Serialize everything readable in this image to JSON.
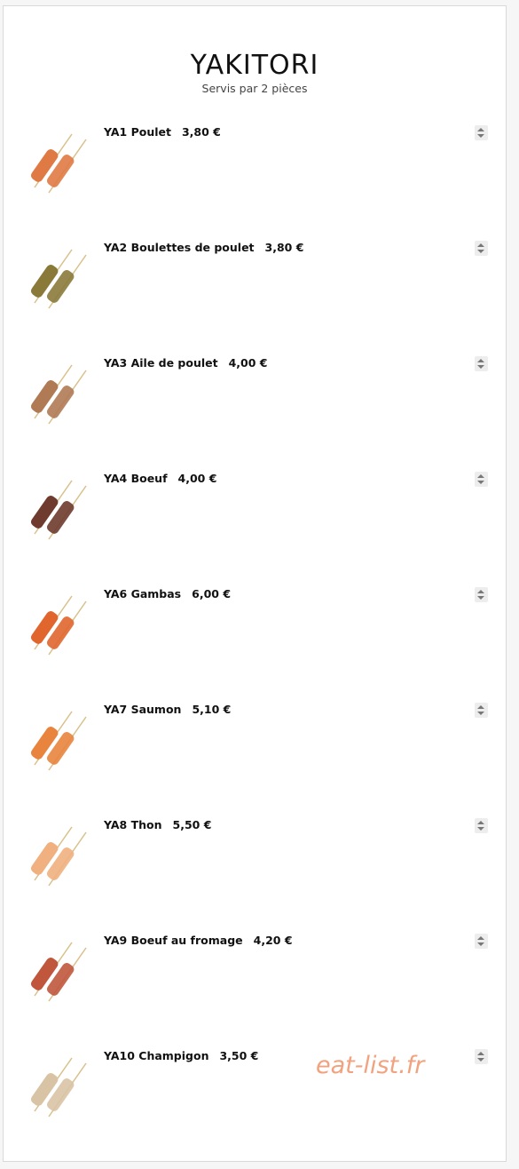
{
  "menu": {
    "title": "YAKITORI",
    "subtitle": "Servis par 2 pièces"
  },
  "items": [
    {
      "name": "YA1 Poulet",
      "price": "3,80 €",
      "icon": "chicken-skewer-icon",
      "color": "#e07a45"
    },
    {
      "name": "YA2 Boulettes de poulet",
      "price": "3,80 €",
      "icon": "chicken-meatball-skewer-icon",
      "color": "#8a7a3a"
    },
    {
      "name": "YA3 Aile de poulet",
      "price": "4,00 €",
      "icon": "chicken-wing-skewer-icon",
      "color": "#b07a55"
    },
    {
      "name": "YA4 Boeuf",
      "price": "4,00 €",
      "icon": "beef-skewer-icon",
      "color": "#6e3b2e"
    },
    {
      "name": "YA6 Gambas",
      "price": "6,00 €",
      "icon": "shrimp-skewer-icon",
      "color": "#e0662e"
    },
    {
      "name": "YA7 Saumon",
      "price": "5,10 €",
      "icon": "salmon-skewer-icon",
      "color": "#e8843e"
    },
    {
      "name": "YA8 Thon",
      "price": "5,50 €",
      "icon": "tuna-skewer-icon",
      "color": "#f0b07f"
    },
    {
      "name": "YA9 Boeuf au fromage",
      "price": "4,20 €",
      "icon": "beef-cheese-skewer-icon",
      "color": "#c0563c"
    },
    {
      "name": "YA10 Champigon",
      "price": "3,50 €",
      "icon": "mushroom-skewer-icon",
      "color": "#d9c3a5"
    }
  ],
  "watermark": "eat-list.fr"
}
